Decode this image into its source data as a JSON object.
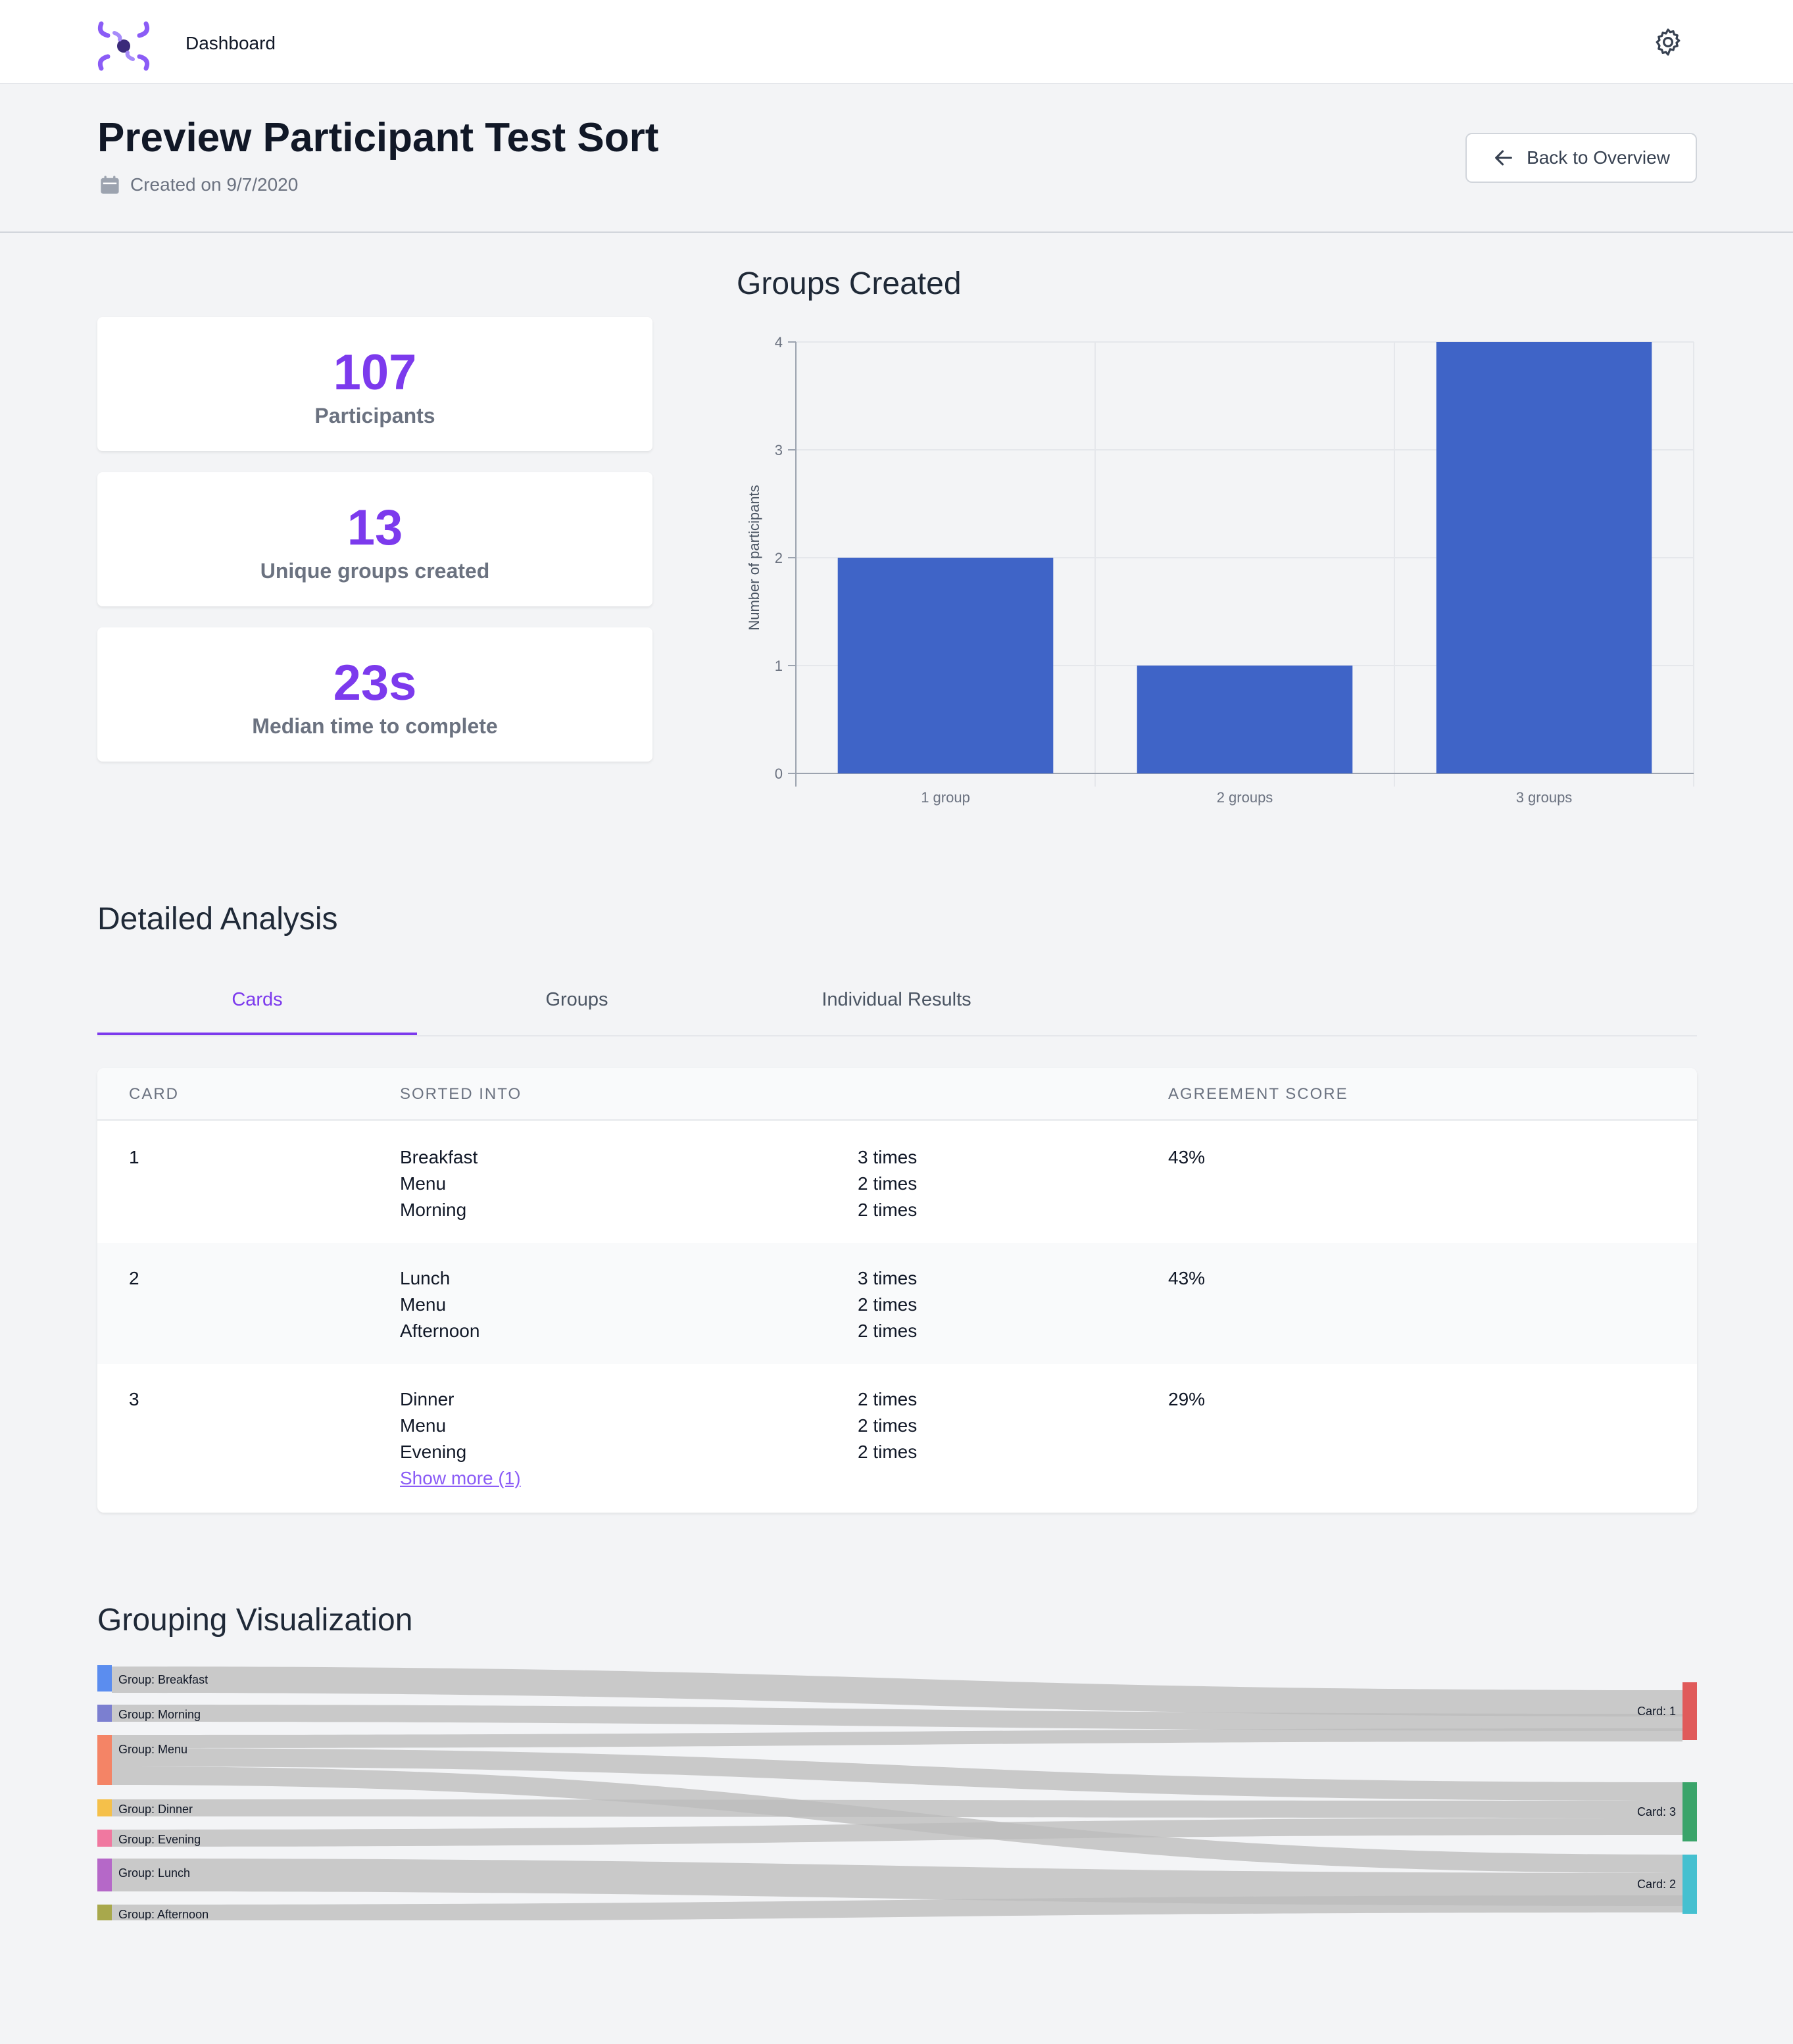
{
  "nav": {
    "dashboard_label": "Dashboard",
    "logo_icon": "logo-icon",
    "settings_icon": "gear-icon"
  },
  "header": {
    "title": "Preview Participant Test Sort",
    "created": "Created on 9/7/2020",
    "calendar_icon": "calendar-icon",
    "back_label": "Back to Overview",
    "back_icon": "arrow-left-icon"
  },
  "stats": [
    {
      "value": "107",
      "label": "Participants"
    },
    {
      "value": "13",
      "label": "Unique groups created"
    },
    {
      "value": "23s",
      "label": "Median time to complete"
    }
  ],
  "groups_chart_title": "Groups Created",
  "chart_data": {
    "type": "bar",
    "title": "Groups Created",
    "categories": [
      "1 group",
      "2 groups",
      "3 groups"
    ],
    "values": [
      2,
      1,
      4
    ],
    "xlabel": "",
    "ylabel": "Number of participants",
    "ylim": [
      0,
      4
    ],
    "yticks": [
      "0",
      "1",
      "2",
      "3",
      "4"
    ],
    "grid": true,
    "bar_color": "#3f64c7"
  },
  "analysis": {
    "title": "Detailed Analysis",
    "tabs": [
      {
        "label": "Cards",
        "active": true
      },
      {
        "label": "Groups",
        "active": false
      },
      {
        "label": "Individual Results",
        "active": false
      }
    ],
    "table": {
      "headers": {
        "card": "CARD",
        "sorted_into": "SORTED INTO",
        "agreement": "AGREEMENT SCORE"
      },
      "rows": [
        {
          "card": "1",
          "groups": [
            "Breakfast",
            "Menu",
            "Morning"
          ],
          "counts": [
            "3 times",
            "2 times",
            "2 times"
          ],
          "agreement": "43%"
        },
        {
          "card": "2",
          "groups": [
            "Lunch",
            "Menu",
            "Afternoon"
          ],
          "counts": [
            "3 times",
            "2 times",
            "2 times"
          ],
          "agreement": "43%"
        },
        {
          "card": "3",
          "groups": [
            "Dinner",
            "Menu",
            "Evening"
          ],
          "counts": [
            "2 times",
            "2 times",
            "2 times"
          ],
          "agreement": "29%",
          "show_more": "Show more (1)"
        }
      ]
    }
  },
  "grouping": {
    "title": "Grouping Visualization",
    "sources": [
      {
        "label": "Group: Breakfast",
        "color": "#5b8def"
      },
      {
        "label": "Group: Morning",
        "color": "#7b7fd0"
      },
      {
        "label": "Group: Menu",
        "color": "#f48466"
      },
      {
        "label": "Group: Dinner",
        "color": "#f5c04a"
      },
      {
        "label": "Group: Evening",
        "color": "#f078a0"
      },
      {
        "label": "Group: Lunch",
        "color": "#b568c8"
      },
      {
        "label": "Group: Afternoon",
        "color": "#a8a84c"
      }
    ],
    "targets": [
      {
        "label": "Card: 1",
        "color": "#e05a5a"
      },
      {
        "label": "Card: 3",
        "color": "#3aa46a"
      },
      {
        "label": "Card: 2",
        "color": "#45c0d0"
      }
    ],
    "flow_color": "#bdbdbd"
  }
}
